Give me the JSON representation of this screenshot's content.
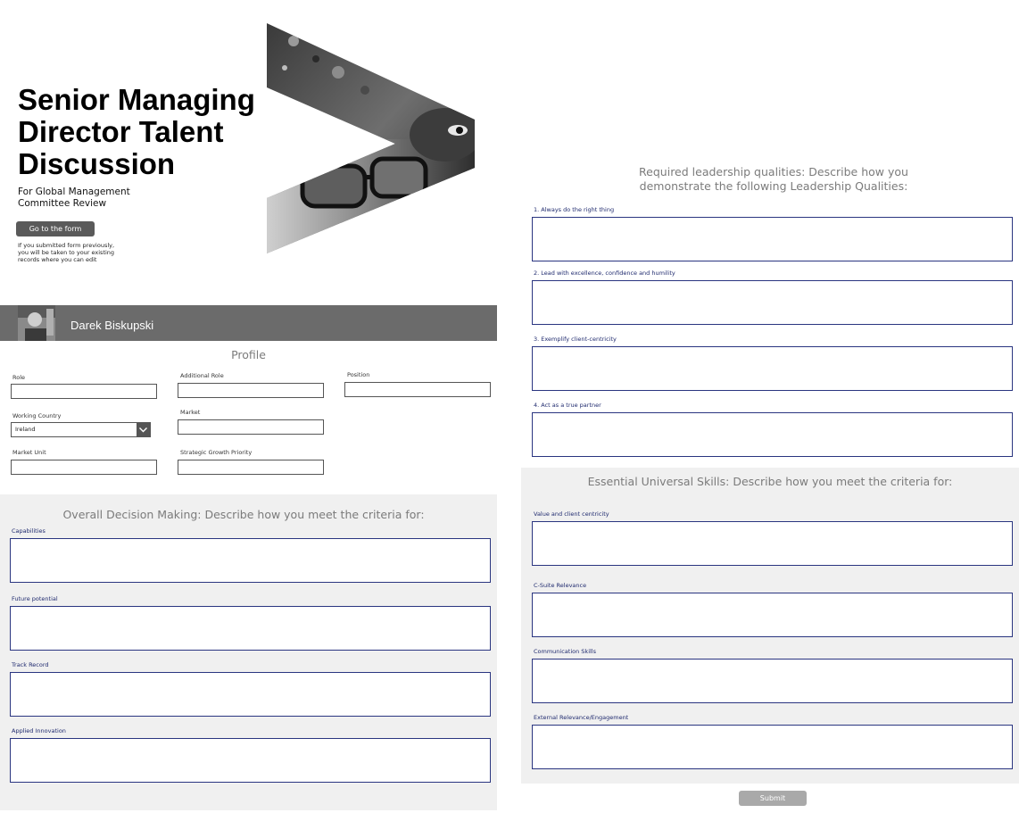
{
  "hero": {
    "title_lines": [
      "Senior Managing",
      "Director Talent",
      "Discussion"
    ],
    "subtitle_lines": [
      "For Global Management",
      "Committee Review"
    ],
    "go_button": "Go to the form",
    "note_lines": [
      "If you submitted form previously,",
      "you will be taken to your existing",
      "records where you can edit"
    ]
  },
  "profile": {
    "user_name": "Darek Biskupski",
    "title": "Profile",
    "fields": {
      "role": "Role",
      "additional_role": "Additional Role",
      "position": "Position",
      "working_country": "Working Country",
      "working_country_value": "Ireland",
      "market": "Market",
      "market_unit": "Market Unit",
      "strategic_growth_priority": "Strategic Growth Priority"
    }
  },
  "decision_making": {
    "heading": "Overall Decision Making: Describe how you meet the criteria for:",
    "questions": [
      "Capabilities",
      "Future potential",
      "Track Record",
      "Applied Innovation"
    ]
  },
  "leadership": {
    "heading_lines": [
      "Required leadership qualities: Describe how you",
      "demonstrate the following Leadership Qualities:"
    ],
    "questions": [
      "1. Always do the right thing",
      "2. Lead with excellence, confidence and humility",
      "3. Exemplify client-centricity",
      "4. Act as a true partner"
    ]
  },
  "universal_skills": {
    "heading": "Essential Universal Skills: Describe how you meet the criteria for:",
    "questions": [
      "Value and client centricity",
      "C-Suite Relevance",
      "Communication Skills",
      "External Relevance/Engagement"
    ]
  },
  "submit_label": "Submit",
  "colors": {
    "profile_bar": "#6b6b6b",
    "panel_bg": "#f0f0f0",
    "label_navy": "#1f2a6e",
    "box_border": "#2a3580",
    "button_dark": "#5a5a5a",
    "button_disabled": "#a9a9a9"
  }
}
